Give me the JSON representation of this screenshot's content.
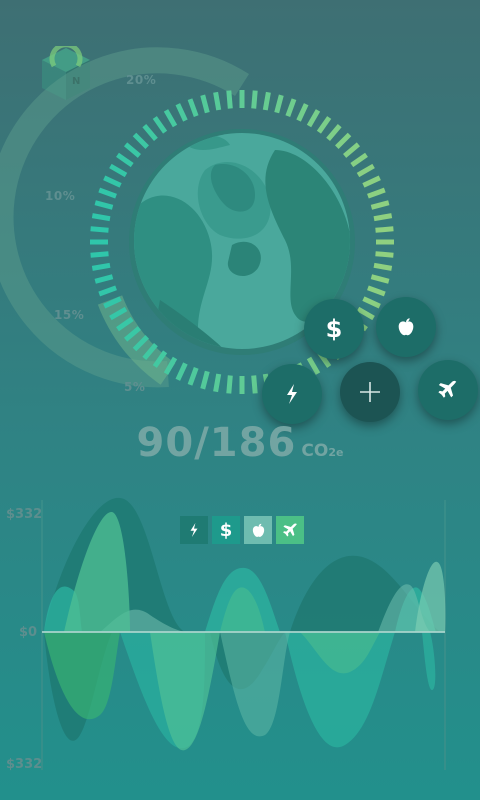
{
  "app": {
    "logo_letter": "N"
  },
  "gauge": {
    "pct_labels": [
      "20%",
      "10%",
      "15%",
      "5%"
    ],
    "colors": {
      "inner_earth": "#4aa89c",
      "tick_start": "#2fc6aa",
      "tick_end": "#8fd080"
    }
  },
  "actions": {
    "add": {
      "icon": "plus-icon"
    },
    "items": [
      {
        "name": "money",
        "icon": "dollar-icon",
        "glyph": "$"
      },
      {
        "name": "food",
        "icon": "apple-icon"
      },
      {
        "name": "energy",
        "icon": "lightning-icon"
      },
      {
        "name": "travel",
        "icon": "airplane-icon"
      }
    ]
  },
  "score": {
    "value": "90/186",
    "unit": "CO",
    "unit_sub": "2e"
  },
  "chart": {
    "y_top": "$332",
    "y_mid": "$0",
    "y_bottom": "$332",
    "legend": [
      {
        "icon": "lightning-icon",
        "color": "#1f7b73"
      },
      {
        "icon": "dollar-icon",
        "color": "#1e9a8c",
        "glyph": "$"
      },
      {
        "icon": "apple-icon",
        "color": "#6fbcb0"
      },
      {
        "icon": "airplane-icon",
        "color": "#4bbf86"
      }
    ]
  }
}
